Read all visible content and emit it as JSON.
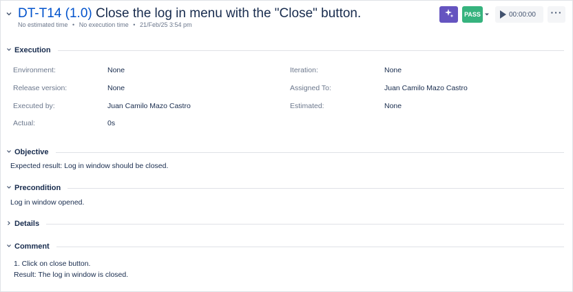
{
  "header": {
    "key": "DT-T14",
    "version": "(1.0)",
    "title": "Close the log in menu with the \"Close\" button.",
    "meta": {
      "estimated": "No estimated time",
      "execution": "No execution time",
      "date": "21/Feb/25 3:54 pm"
    },
    "status_label": "PASS",
    "timer": "00:00:00",
    "more_label": "···"
  },
  "execution": {
    "title": "Execution",
    "fields": {
      "environment": {
        "label": "Environment:",
        "value": "None"
      },
      "iteration": {
        "label": "Iteration:",
        "value": "None"
      },
      "release_version": {
        "label": "Release version:",
        "value": "None"
      },
      "assigned_to": {
        "label": "Assigned To:",
        "value": "Juan Camilo Mazo Castro"
      },
      "executed_by": {
        "label": "Executed by:",
        "value": "Juan Camilo Mazo Castro"
      },
      "estimated": {
        "label": "Estimated:",
        "value": "None"
      },
      "actual": {
        "label": "Actual:",
        "value": "0s"
      }
    }
  },
  "objective": {
    "title": "Objective",
    "text": "Expected result: Log in window should be closed."
  },
  "precondition": {
    "title": "Precondition",
    "text": "Log in window opened."
  },
  "details": {
    "title": "Details"
  },
  "comment": {
    "title": "Comment",
    "line1": "1. Click on close button.",
    "line2": "Result: The log in window is closed."
  },
  "colors": {
    "link_blue": "#0052cc",
    "pass_green": "#36b37e",
    "ai_purple": "#6554c0",
    "text_dark": "#172b4d",
    "text_muted": "#6b778c"
  }
}
